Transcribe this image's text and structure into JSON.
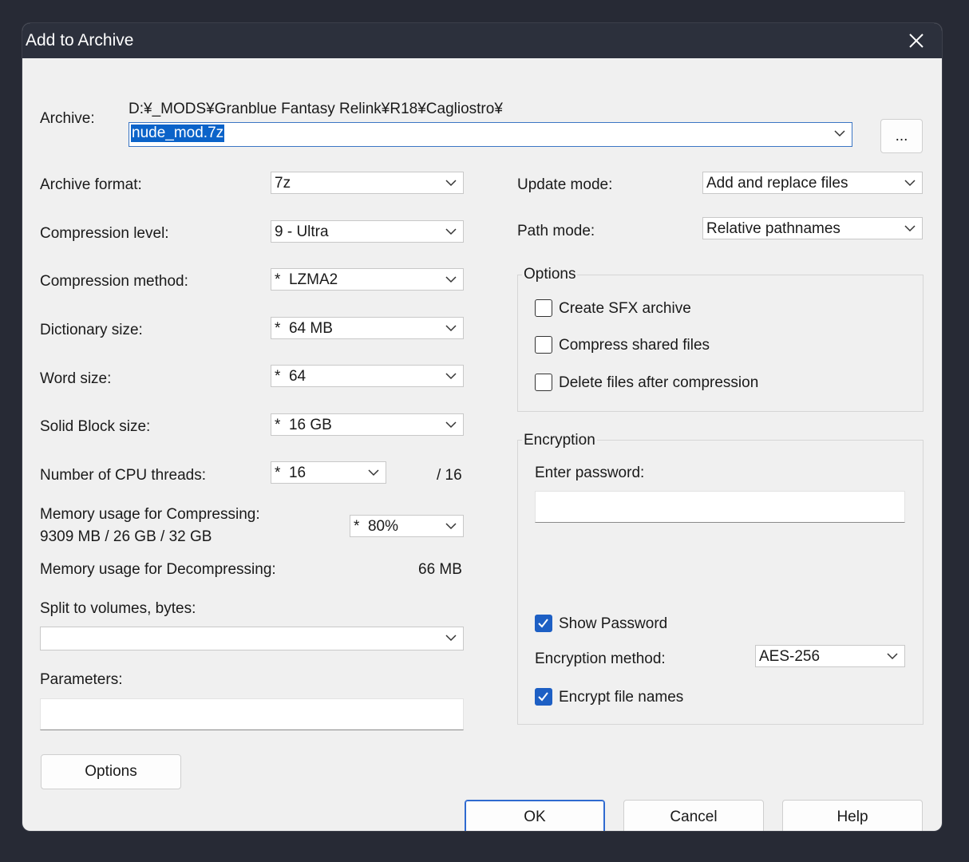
{
  "window": {
    "title": "Add to Archive"
  },
  "archive": {
    "label": "Archive:",
    "path": "D:¥_MODS¥Granblue Fantasy Relink¥R18¥Cagliostro¥",
    "filename": "nude_mod.7z",
    "browse_label": "..."
  },
  "left": {
    "format_label": "Archive format:",
    "format_value": "7z",
    "level_label": "Compression level:",
    "level_value": "9 - Ultra",
    "method_label": "Compression method:",
    "method_value": "*  LZMA2",
    "dict_label": "Dictionary size:",
    "dict_value": "*  64 MB",
    "word_label": "Word size:",
    "word_value": "*  64",
    "solid_label": "Solid Block size:",
    "solid_value": "*  16 GB",
    "threads_label": "Number of CPU threads:",
    "threads_value": "*  16",
    "threads_max": "/ 16",
    "mem_comp_label": "Memory usage for Compressing:",
    "mem_comp_detail": "9309 MB / 26 GB / 32 GB",
    "mem_comp_value": "*  80%",
    "mem_decomp_label": "Memory usage for Decompressing:",
    "mem_decomp_value": "66 MB",
    "split_label": "Split to volumes, bytes:",
    "split_value": "",
    "params_label": "Parameters:",
    "params_value": "",
    "options_button": "Options"
  },
  "right": {
    "update_label": "Update mode:",
    "update_value": "Add and replace files",
    "path_label": "Path mode:",
    "path_value": "Relative pathnames",
    "options_group": "Options",
    "opt_sfx": "Create SFX archive",
    "opt_shared": "Compress shared files",
    "opt_delete": "Delete files after compression",
    "encryption_group": "Encryption",
    "password_label": "Enter password:",
    "password_value": "",
    "show_password": "Show Password",
    "enc_method_label": "Encryption method:",
    "enc_method_value": "AES-256",
    "encrypt_names": "Encrypt file names"
  },
  "buttons": {
    "ok": "OK",
    "cancel": "Cancel",
    "help": "Help"
  },
  "colors": {
    "accent": "#1d5fc4",
    "titlebar": "#2c303c",
    "selection": "#0b63c9"
  }
}
